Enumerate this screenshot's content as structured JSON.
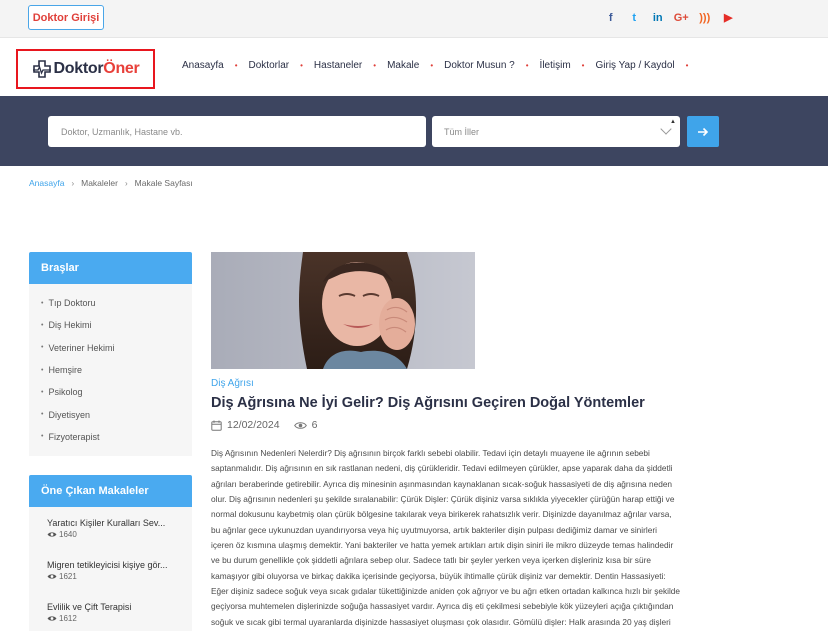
{
  "topbar": {
    "login_label": "Doktor Girişi",
    "social": [
      {
        "icon": "facebook-icon",
        "glyph": "f",
        "color": "#3b5998"
      },
      {
        "icon": "twitter-icon",
        "glyph": "t",
        "color": "#1da1f2"
      },
      {
        "icon": "linkedin-icon",
        "glyph": "in",
        "color": "#0077b5"
      },
      {
        "icon": "google-plus-icon",
        "glyph": "G+",
        "color": "#dd4b39"
      },
      {
        "icon": "rss-icon",
        "glyph": ")))",
        "color": "#f26522"
      },
      {
        "icon": "youtube-icon",
        "glyph": "▶",
        "color": "#e52d27"
      }
    ]
  },
  "logo": {
    "part1": "Doktor",
    "part2": "Öner"
  },
  "nav": {
    "items": [
      "Anasayfa",
      "Doktorlar",
      "Hastaneler",
      "Makale",
      "Doktor Musun ?",
      "İletişim",
      "Giriş Yap / Kaydol"
    ]
  },
  "search": {
    "placeholder": "Doktor, Uzmanlık, Hastane vb.",
    "city_selected": "Tüm İller"
  },
  "breadcrumb": {
    "home": "Anasayfa",
    "b2": "Makaleler",
    "b3": "Makale Sayfası"
  },
  "sidebar": {
    "branches_title": "Braşlar",
    "branches": [
      "Tıp Doktoru",
      "Diş Hekimi",
      "Veteriner Hekimi",
      "Hemşire",
      "Psikolog",
      "Diyetisyen",
      "Fizyoterapist"
    ],
    "featured_title": "Öne Çıkan Makaleler",
    "featured": [
      {
        "title": "Yaratıcı Kişiler Kuralları Sev...",
        "views": "1640"
      },
      {
        "title": "Migren tetikleyicisi kişiye gör...",
        "views": "1621"
      },
      {
        "title": "Evlilik ve Çift Terapisi",
        "views": "1612"
      }
    ]
  },
  "article": {
    "category": "Diş Ağrısı",
    "title": "Diş Ağrısına Ne İyi Gelir? Diş Ağrısını Geçiren Doğal Yöntemler",
    "date": "12/02/2024",
    "views": "6",
    "lines": [
      "Diş Ağrısının Nedenleri Nelerdir? Diş ağrısının birçok farklı sebebi olabilir. Tedavi için detaylı muayene ile ağrının sebebi",
      "saptanmalıdır. Diş ağrısının en sık rastlanan nedeni, diş çürükleridir. Tedavi edilmeyen çürükler, apse yaparak daha da şiddetli",
      "ağrıları beraberinde getirebilir. Ayrıca diş minesinin aşınmasından kaynaklanan sıcak-soğuk hassasiyeti de diş ağrısına neden",
      "olur. Diş ağrısının nedenleri şu şekilde sıralanabilir: Çürük Dişler: Çürük dişiniz varsa sıklıkla yiyecekler çürüğün harap ettiği ve",
      "normal dokusunu kaybetmiş olan çürük bölgesine takılarak veya birikerek rahatsızlık verir. Dişinizde dayanılmaz ağrılar varsa,",
      "bu ağrılar gece uykunuzdan uyandırıyorsa veya hiç uyutmuyorsa, artık bakteriler dişin pulpası dediğimiz damar ve sinirleri",
      "içeren öz kısmına ulaşmış demektir. Yani bakteriler ve hatta yemek artıkları artık dişin siniri ile mikro düzeyde temas halindedir",
      "ve bu durum genellikle çok şiddetli ağrılara sebep olur. Sadece tatlı bir şeyler yerken veya içerken dişleriniz kısa bir süre",
      "kamaşıyor gibi oluyorsa ve birkaç dakika içerisinde geçiyorsa, büyük ihtimalle çürük dişiniz var demektir. Dentin Hassasiyeti:",
      "Eğer dişiniz sadece soğuk veya sıcak gıdalar tükettiğinizde aniden çok ağrıyor ve bu ağrı etken ortadan kalkınca hızlı bir şekilde",
      "geçiyorsa muhtemelen dişlerinizde soğuğa hassasiyet vardır. Ayrıca diş eti çekilmesi sebebiyle kök yüzeyleri açığa çıktığından",
      "soğuk ve sıcak gibi termal uyaranlarda dişinizde hassasiyet oluşması çok olasıdır. Gömülü dişler: Halk arasında 20 yaş dişleri"
    ]
  }
}
